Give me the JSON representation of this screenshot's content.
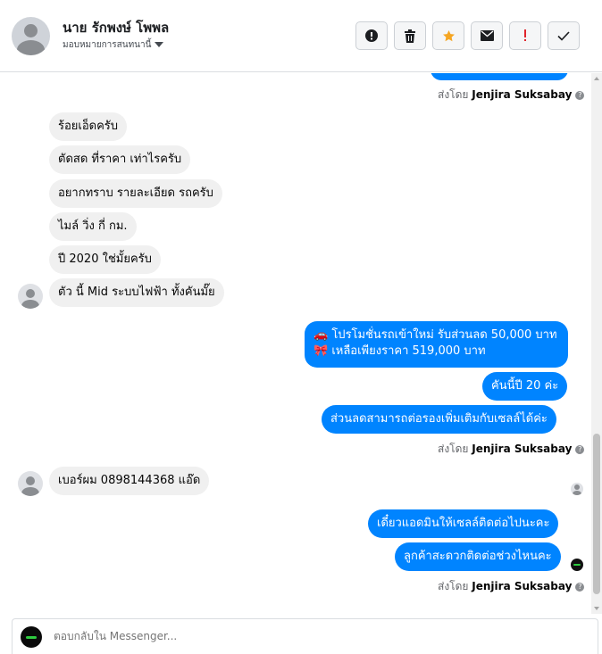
{
  "header": {
    "contact_name": "นาย รักพงษ์ โพพล",
    "assign_label": "มอบหมายการสนทนานี้",
    "actions": [
      "spam-icon",
      "trash-icon",
      "star-icon",
      "envelope-icon",
      "exclamation-icon",
      "check-icon"
    ]
  },
  "thread": {
    "top_partial_sentby": {
      "prefix": "ส่งโดย",
      "name": "Jenjira Suksabay"
    },
    "incoming_group_1": [
      "ร้อยเอ็ดครับ",
      "ตัดสด ที่ราคา เท่าไรครับ",
      "อยากทราบ รายละเอียด รถครับ",
      "ไมล์ วิ่ง กี่ กม.",
      "ปี 2020 ใช่มั้ยครับ",
      "ตัว นี้ Mid ระบบไฟฟ้า ทั้งคันมั๊ย"
    ],
    "outgoing_group_1": {
      "promo_line_1": "โปรโมชั่นรถเข้าใหม่ รับส่วนลด 50,000 บาท",
      "promo_line_2": "เหลือเพียงราคา 519,000 บาท",
      "promo_icon_1": "🚗",
      "promo_icon_2": "🎀",
      "msg_2": "คันนี้ปี 20 ค่ะ",
      "msg_3": "ส่วนลดสามารถต่อรองเพิ่มเติมกับเซลล์ได้ค่ะ"
    },
    "sentby_1": {
      "prefix": "ส่งโดย",
      "name": "Jenjira Suksabay"
    },
    "incoming_group_2": [
      "เบอร์ผม 0898144368 แอ๊ด"
    ],
    "outgoing_group_2": [
      "เดี๋ยวแอดมินให้เซลล์ติดต่อไปนะคะ",
      "ลูกค้าสะดวกติดต่อช่วงไหนคะ"
    ],
    "sentby_2": {
      "prefix": "ส่งโดย",
      "name": "Jenjira Suksabay"
    }
  },
  "composer": {
    "placeholder": "ตอบกลับใน Messenger..."
  },
  "colors": {
    "outgoing_bubble": "#0084ff",
    "incoming_bubble": "#f0f0f0",
    "star_accent": "#f5a623",
    "exclamation_accent": "#e0242c"
  }
}
